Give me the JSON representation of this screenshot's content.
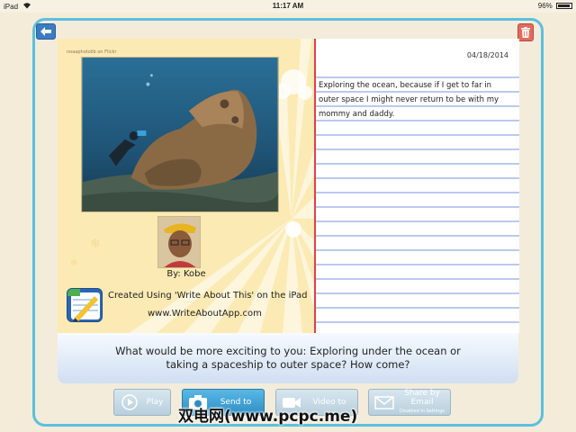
{
  "status_bar": {
    "device": "iPad",
    "time": "11:17 AM",
    "battery": "96%",
    "battery_level": 0.96
  },
  "page": {
    "photo_credit": "noaaphotolib on Flickr",
    "byline": "By: Kobe",
    "app_credit_line1": "Created Using 'Write About This' on the iPad",
    "app_credit_line2": "www.WriteAboutApp.com",
    "date": "04/18/2014",
    "entry_text": "Exploring the ocean, because if I get to far in outer space I might never return to be with my mommy and daddy."
  },
  "prompt": {
    "text": "What would be more exciting to you: Exploring under the ocean or taking a spaceship to outer space? How come?"
  },
  "buttons": {
    "play": "Play",
    "send": "Send to",
    "video": "Video to",
    "email": "Share by Email",
    "email_sub": "Disabled in Settings"
  },
  "watermark": "双电网(www.pcpc.me)",
  "colors": {
    "frame_border": "#5bc0de",
    "margin_line": "#e04050",
    "rule_line": "#4a6fd8",
    "panel_bg": "#fbeab3"
  },
  "icons": {
    "back": "back-arrow-icon",
    "trash": "trash-icon",
    "play": "play-icon",
    "camera": "camera-icon",
    "video": "video-camera-icon",
    "email": "envelope-icon"
  }
}
